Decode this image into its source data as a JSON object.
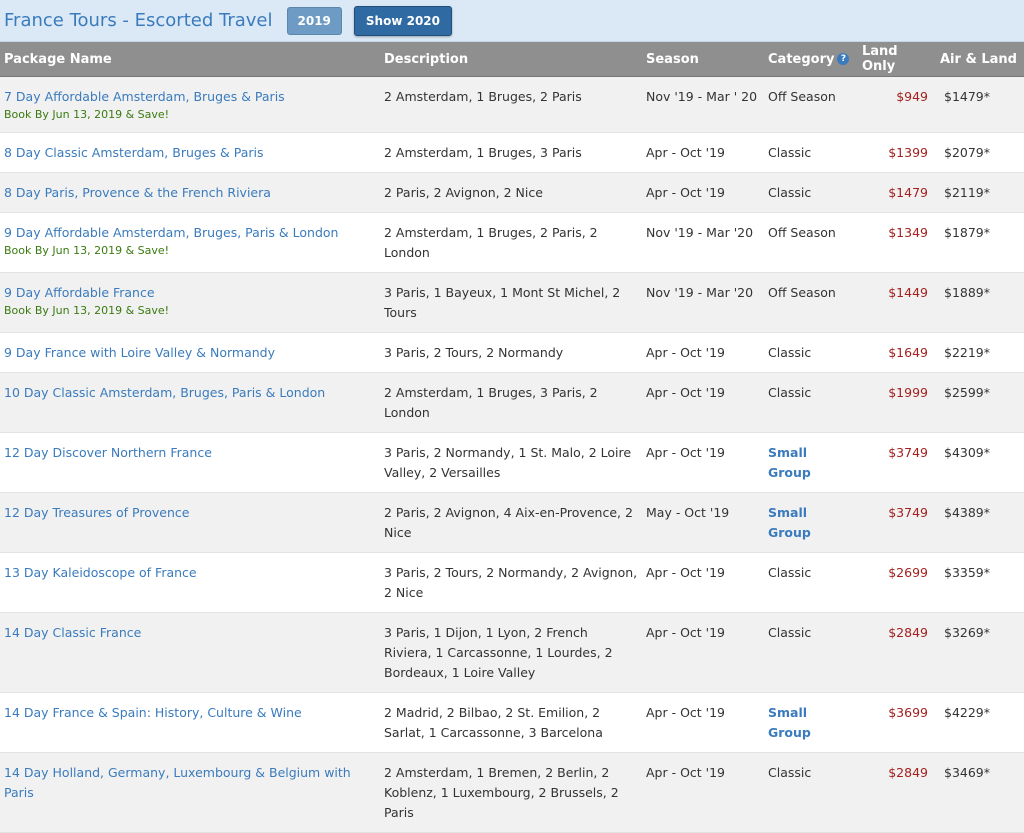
{
  "header": {
    "title": "France Tours - Escorted Travel",
    "year_label": "2019",
    "show_label": "Show 2020"
  },
  "columns": {
    "package": "Package Name",
    "description": "Description",
    "season": "Season",
    "category": "Category",
    "land": "Land Only",
    "air": "Air & Land"
  },
  "rows": [
    {
      "name": "7 Day Affordable Amsterdam, Bruges & Paris",
      "promo": "Book By Jun 13, 2019 & Save!",
      "description": "2 Amsterdam, 1 Bruges, 2 Paris",
      "season": "Nov '19 - Mar ' 20",
      "category": "Off Season",
      "land": "$949",
      "air": "$1479*"
    },
    {
      "name": "8 Day Classic Amsterdam, Bruges & Paris",
      "promo": "",
      "description": "2 Amsterdam, 1 Bruges, 3 Paris",
      "season": "Apr - Oct '19",
      "category": "Classic",
      "land": "$1399",
      "air": "$2079*"
    },
    {
      "name": "8 Day Paris, Provence & the French Riviera",
      "promo": "",
      "description": "2 Paris, 2 Avignon, 2 Nice",
      "season": "Apr - Oct '19",
      "category": "Classic",
      "land": "$1479",
      "air": "$2119*"
    },
    {
      "name": "9 Day Affordable Amsterdam, Bruges, Paris & London",
      "promo": "Book By Jun 13, 2019 & Save!",
      "description": "2 Amsterdam, 1 Bruges, 2 Paris, 2 London",
      "season": "Nov '19 - Mar '20",
      "category": "Off Season",
      "land": "$1349",
      "air": "$1879*"
    },
    {
      "name": "9 Day Affordable France",
      "promo": "Book By Jun 13, 2019 & Save!",
      "description": "3 Paris, 1 Bayeux, 1 Mont St Michel, 2 Tours",
      "season": "Nov '19 - Mar '20",
      "category": "Off Season",
      "land": "$1449",
      "air": "$1889*"
    },
    {
      "name": "9 Day France with Loire Valley & Normandy",
      "promo": "",
      "description": "3 Paris, 2 Tours, 2 Normandy",
      "season": "Apr - Oct '19",
      "category": "Classic",
      "land": "$1649",
      "air": "$2219*"
    },
    {
      "name": "10 Day Classic Amsterdam, Bruges, Paris & London",
      "promo": "",
      "description": "2 Amsterdam, 1 Bruges, 3 Paris, 2 London",
      "season": "Apr - Oct '19",
      "category": "Classic",
      "land": "$1999",
      "air": "$2599*"
    },
    {
      "name": "12 Day Discover Northern France",
      "promo": "",
      "description": "3 Paris, 2 Normandy, 1 St. Malo, 2 Loire Valley, 2 Versailles",
      "season": "Apr - Oct '19",
      "category": "Small Group",
      "land": "$3749",
      "air": "$4309*"
    },
    {
      "name": "12 Day Treasures of Provence",
      "promo": "",
      "description": "2 Paris, 2 Avignon, 4 Aix-en-Provence, 2 Nice",
      "season": "May - Oct '19",
      "category": "Small Group",
      "land": "$3749",
      "air": "$4389*"
    },
    {
      "name": "13 Day Kaleidoscope of France",
      "promo": "",
      "description": "3 Paris, 2 Tours, 2 Normandy, 2 Avignon, 2 Nice",
      "season": "Apr - Oct '19",
      "category": "Classic",
      "land": "$2699",
      "air": "$3359*"
    },
    {
      "name": "14 Day Classic France",
      "promo": "",
      "description": "3 Paris, 1 Dijon, 1 Lyon, 2 French Riviera, 1 Carcassonne, 1 Lourdes, 2 Bordeaux, 1 Loire Valley",
      "season": "Apr - Oct '19",
      "category": "Classic",
      "land": "$2849",
      "air": "$3269*"
    },
    {
      "name": "14 Day France & Spain: History, Culture & Wine",
      "promo": "",
      "description": "2 Madrid, 2 Bilbao, 2 St. Emilion, 2 Sarlat, 1 Carcassonne, 3 Barcelona",
      "season": "Apr - Oct '19",
      "category": "Small Group",
      "land": "$3699",
      "air": "$4229*"
    },
    {
      "name": "14 Day Holland, Germany, Luxembourg & Belgium with Paris",
      "promo": "",
      "description": "2 Amsterdam, 1 Bremen, 2 Berlin, 2 Koblenz, 1 Luxembourg, 2 Brussels, 2 Paris",
      "season": "Apr - Oct '19",
      "category": "Classic",
      "land": "$2849",
      "air": "$3469*"
    }
  ]
}
